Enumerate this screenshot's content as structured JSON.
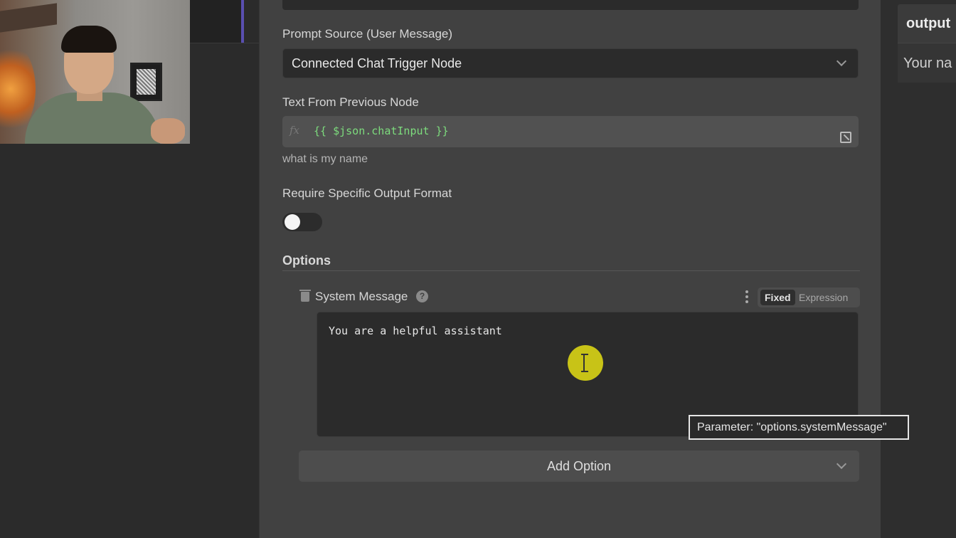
{
  "panel": {
    "prompt_source": {
      "label": "Prompt Source (User Message)",
      "value": "Connected Chat Trigger Node"
    },
    "text_from_previous": {
      "label": "Text From Previous Node",
      "expression": "{{ $json.chatInput }}",
      "hint": "what is my name"
    },
    "output_format": {
      "label": "Require Specific Output Format",
      "enabled": false
    },
    "options": {
      "title": "Options",
      "system_message": {
        "label": "System Message",
        "mode_fixed": "Fixed",
        "mode_expression": "Expression",
        "value": "You are a helpful assistant"
      },
      "add_option_label": "Add Option"
    }
  },
  "output_panel": {
    "title": "output",
    "preview": "Your na"
  },
  "tooltip": {
    "text": "Parameter: \"options.systemMessage\""
  }
}
